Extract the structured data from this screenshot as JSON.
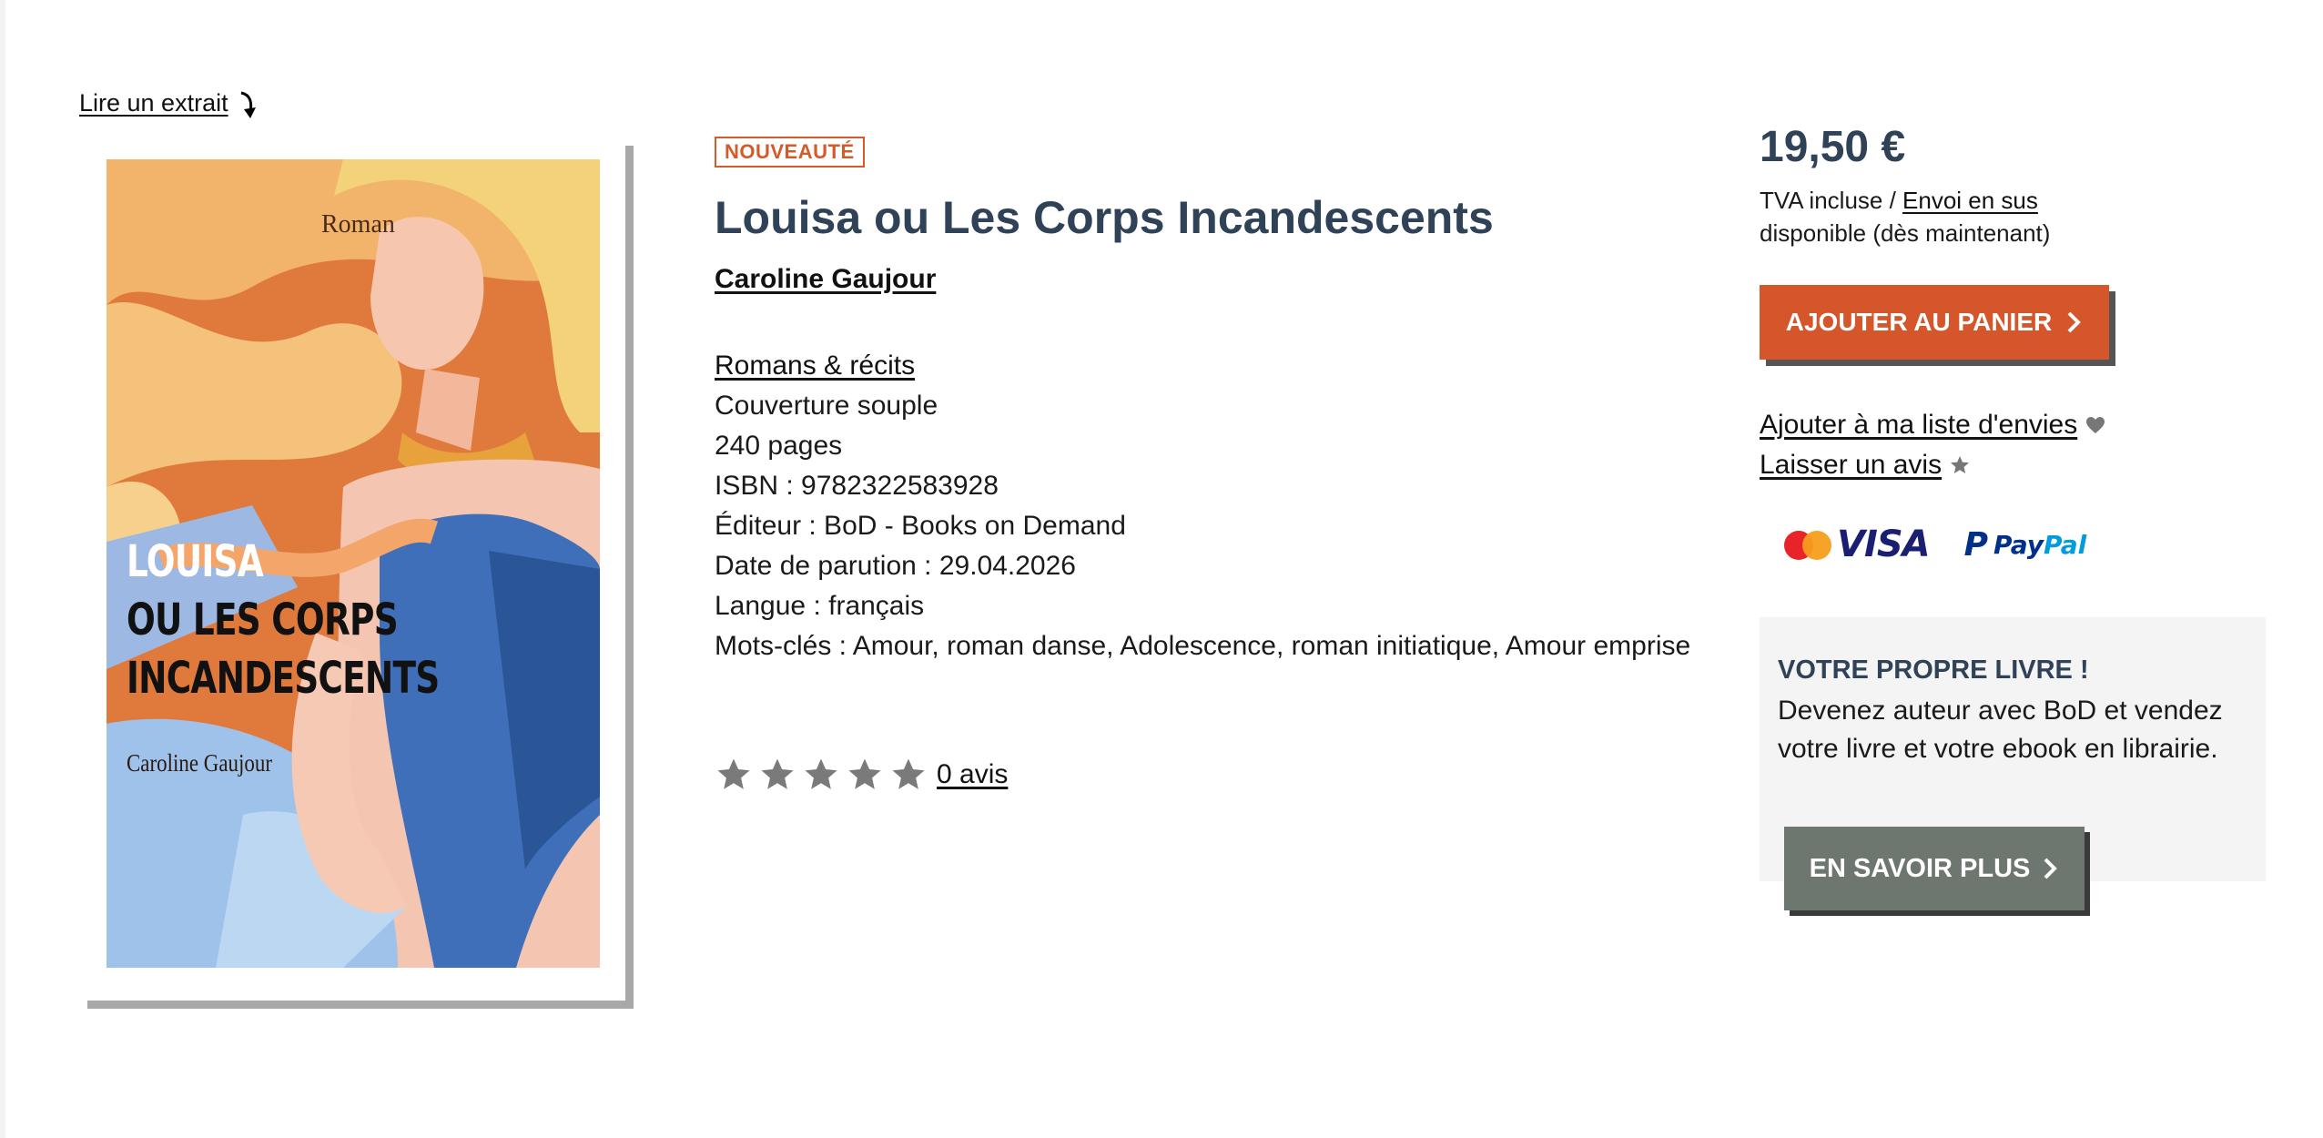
{
  "excerpt": {
    "label": "Lire un extrait",
    "icon": "arrow-down-curved-icon"
  },
  "cover": {
    "genre": "Roman",
    "title_line1": "LOUISA",
    "title_line2": "OU LES CORPS",
    "title_line3": "INCANDESCENTS",
    "author": "Caroline Gaujour"
  },
  "product": {
    "badge": "NOUVEAUTÉ",
    "title": "Louisa ou Les Corps Incandescents",
    "author": "Caroline Gaujour",
    "category": "Romans & récits",
    "details": [
      "Couverture souple",
      "240 pages",
      "ISBN : 9782322583928",
      "Éditeur : BoD - Books on Demand",
      "Date de parution : 29.04.2026",
      "Langue : français",
      "Mots-clés : Amour, roman danse, Adolescence, roman initiatique, Amour emprise"
    ],
    "rating": {
      "value": 0,
      "max": 5,
      "reviews_label": "0 avis"
    }
  },
  "purchase": {
    "price": "19,50 €",
    "tax_prefix": "TVA incluse / ",
    "shipping_link": "Envoi en sus",
    "availability": "disponible (dès maintenant)",
    "cart_button": "AJOUTER AU PANIER",
    "wishlist_link": "Ajouter à ma liste d'envies",
    "review_link": "Laisser un avis",
    "payment_methods": {
      "mastercard_text": "MasterCard",
      "visa": "VISA",
      "paypal_pay": "Pay",
      "paypal_pal": "Pal"
    }
  },
  "promo": {
    "title": "VOTRE PROPRE LIVRE !",
    "text": "Devenez auteur avec BoD et vendez votre livre et votre ebook en librairie.",
    "button": "EN SAVOIR PLUS"
  },
  "colors": {
    "accent": "#d4562a",
    "heading": "#2f4257",
    "star": "#7a7a7a",
    "promo_bg": "#f4f4f4",
    "promo_button": "#6e7670"
  }
}
